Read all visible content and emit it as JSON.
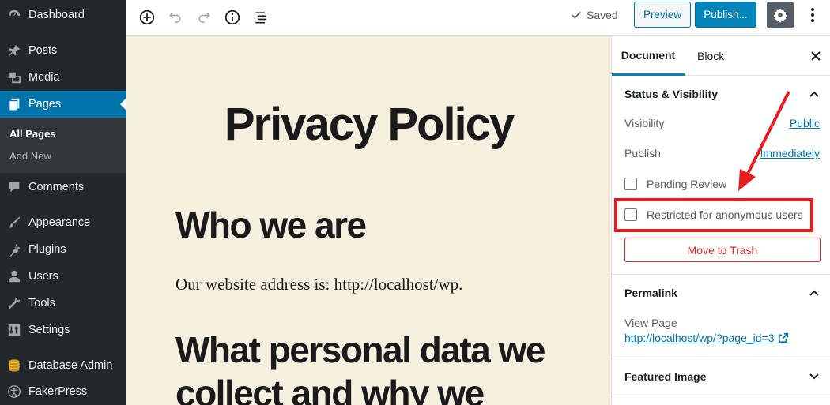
{
  "admin_menu": {
    "items": [
      {
        "label": "Dashboard",
        "icon": "dashboard-icon"
      },
      {
        "label": "Posts",
        "icon": "pin-icon"
      },
      {
        "label": "Media",
        "icon": "media-icon"
      },
      {
        "label": "Pages",
        "icon": "pages-icon"
      },
      {
        "label": "Comments",
        "icon": "comment-icon"
      },
      {
        "label": "Appearance",
        "icon": "brush-icon"
      },
      {
        "label": "Plugins",
        "icon": "plug-icon"
      },
      {
        "label": "Users",
        "icon": "user-icon"
      },
      {
        "label": "Tools",
        "icon": "wrench-icon"
      },
      {
        "label": "Settings",
        "icon": "sliders-icon"
      },
      {
        "label": "Database Admin",
        "icon": "database-icon"
      },
      {
        "label": "FakerPress",
        "icon": "accessibility-icon"
      }
    ],
    "submenu": [
      "All Pages",
      "Add New"
    ]
  },
  "toolbar": {
    "saved_label": "Saved",
    "preview_label": "Preview",
    "publish_label": "Publish..."
  },
  "content": {
    "title": "Privacy Policy",
    "heading1": "Who we are",
    "paragraph": "Our website address is: http://localhost/wp.",
    "heading2": "What personal data we collect and why we"
  },
  "settings": {
    "tabs": [
      "Document",
      "Block"
    ],
    "status_panel": {
      "title": "Status & Visibility",
      "visibility_label": "Visibility",
      "visibility_value": "Public",
      "publish_label": "Publish",
      "publish_value": "Immediately",
      "pending_review": "Pending Review",
      "restricted": "Restricted for anonymous users",
      "trash": "Move to Trash"
    },
    "permalink_panel": {
      "title": "Permalink",
      "view_page": "View Page",
      "url": "http://localhost/wp/?page_id=3"
    },
    "featured_panel": {
      "title": "Featured Image"
    }
  },
  "colors": {
    "sidebar_bg": "#23282d",
    "accent": "#0073aa",
    "annotation": "#e41e1e"
  }
}
